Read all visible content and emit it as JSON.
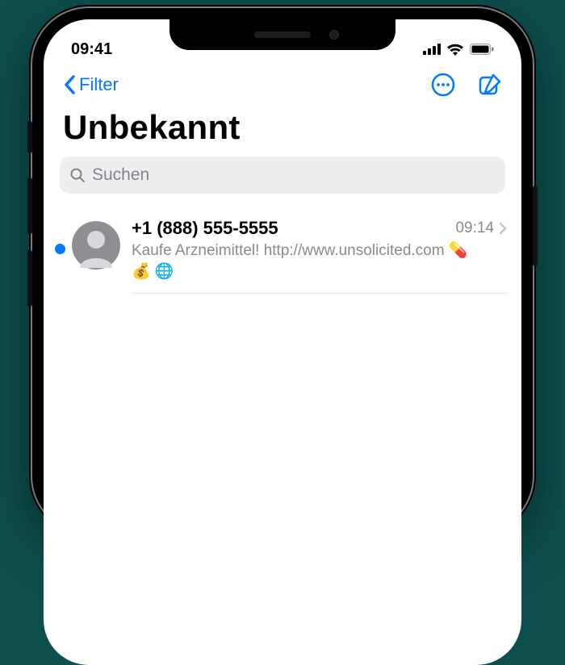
{
  "status": {
    "time": "09:41"
  },
  "nav": {
    "back_label": "Filter"
  },
  "page_title": "Unbekannt",
  "search": {
    "placeholder": "Suchen"
  },
  "conversations": [
    {
      "unread": true,
      "sender": "+1 (888) 555-5555",
      "time": "09:14",
      "preview": "Kaufe Arzneimittel! http://www.unsolicited.com 💊 💰 🌐"
    }
  ],
  "icons": {
    "back_chevron": "chevron-left-icon",
    "more": "more-circle-icon",
    "compose": "compose-icon",
    "search": "search-icon",
    "signal": "cellular-icon",
    "wifi": "wifi-icon",
    "battery": "battery-icon",
    "avatar": "person-circle-icon",
    "disclosure": "chevron-right-icon"
  },
  "colors": {
    "accent": "#007aff"
  }
}
